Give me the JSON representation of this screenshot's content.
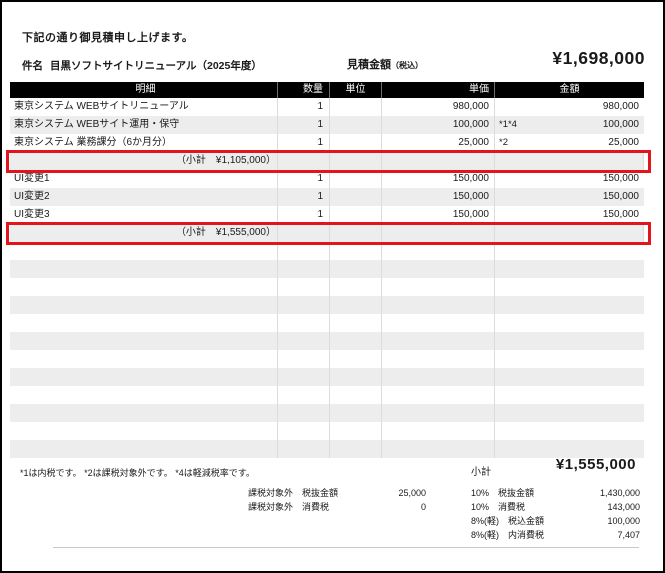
{
  "page": {
    "intro": "下記の通り御見積申し上げます。",
    "subject_label": "件名",
    "subject_value": "目黒ソフトサイトリニューアル（2025年度）",
    "total_label": "見積金額",
    "total_label_note": "（税込）",
    "total_value": "¥1,698,000"
  },
  "table": {
    "headers": [
      "明細",
      "数量",
      "単位",
      "単価",
      "金額"
    ],
    "rows": [
      {
        "type": "item",
        "name": "東京システム WEBサイトリニューアル",
        "qty": "1",
        "unit": "",
        "unit_price": "980,000",
        "note": "",
        "amount": "980,000"
      },
      {
        "type": "item",
        "name": "東京システム WEBサイト運用・保守",
        "qty": "1",
        "unit": "",
        "unit_price": "100,000",
        "note": "*1*4",
        "amount": "100,000"
      },
      {
        "type": "item",
        "name": "東京システム 業務課分（6か月分）",
        "qty": "1",
        "unit": "",
        "unit_price": "25,000",
        "note": "*2",
        "amount": "25,000"
      },
      {
        "type": "subtotal",
        "label": "（小計　¥1,105,000）",
        "highlighted": true
      },
      {
        "type": "item",
        "name": "UI変更1",
        "qty": "1",
        "unit": "",
        "unit_price": "150,000",
        "note": "",
        "amount": "150,000"
      },
      {
        "type": "item",
        "name": "UI変更2",
        "qty": "1",
        "unit": "",
        "unit_price": "150,000",
        "note": "",
        "amount": "150,000"
      },
      {
        "type": "item",
        "name": "UI変更3",
        "qty": "1",
        "unit": "",
        "unit_price": "150,000",
        "note": "",
        "amount": "150,000"
      },
      {
        "type": "subtotal",
        "label": "（小計　¥1,555,000）",
        "highlighted": true
      },
      {
        "type": "empty"
      },
      {
        "type": "empty"
      },
      {
        "type": "empty"
      },
      {
        "type": "empty"
      },
      {
        "type": "empty"
      },
      {
        "type": "empty"
      },
      {
        "type": "empty"
      },
      {
        "type": "empty"
      },
      {
        "type": "empty"
      },
      {
        "type": "empty"
      },
      {
        "type": "empty"
      },
      {
        "type": "empty"
      }
    ]
  },
  "footer": {
    "notes": "*1は内税です。 *2は課税対象外です。 *4は軽減税率です。",
    "subtotal_label": "小計",
    "subtotal_value": "¥1,555,000",
    "mid_summary": [
      {
        "label": "課税対象外　税抜金額",
        "value": "25,000"
      },
      {
        "label": "課税対象外　消費税",
        "value": "0"
      }
    ],
    "right_summary": [
      {
        "label": "10%　税抜金額",
        "value": "1,430,000"
      },
      {
        "label": "10%　消費税",
        "value": "143,000"
      },
      {
        "label": "8%(軽)　税込金額",
        "value": "100,000"
      },
      {
        "label": "8%(軽)　内消費税",
        "value": "7,407"
      }
    ]
  },
  "colors": {
    "highlight_red": "#e2151c",
    "header_bg": "#000000",
    "row_alt_bg": "#ededed"
  }
}
